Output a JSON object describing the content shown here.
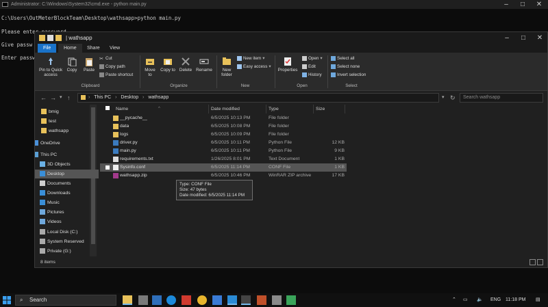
{
  "console": {
    "title": "Administrator: C:\\Windows\\System32\\cmd.exe - python main.py",
    "lines": [
      "C:\\Users\\OutMeterBlockTeam\\Desktop\\wathsapp>python main.py",
      "Please enter password",
      "Give passw",
      "Enter passw"
    ]
  },
  "explorer": {
    "title": "| wathsapp",
    "ribbon_tabs": [
      "File",
      "Home",
      "Share",
      "View"
    ],
    "ribbon": {
      "pin_quick_access": "Pin to Quick access",
      "copy": "Copy",
      "paste": "Paste",
      "cut": "Cut",
      "copy_path": "Copy path",
      "paste_shortcut": "Paste shortcut",
      "move_to": "Move to",
      "copy_to": "Copy to",
      "delete": "Delete",
      "rename": "Rename",
      "new_folder": "New folder",
      "new_item": "New item",
      "easy_access": "Easy access",
      "properties": "Properties",
      "open": "Open",
      "edit": "Edit",
      "history": "History",
      "select_all": "Select all",
      "select_none": "Select none",
      "invert_selection": "Invert selection",
      "groups": {
        "clipboard": "Clipboard",
        "organize": "Organize",
        "new": "New",
        "open": "Open",
        "select": "Select"
      }
    },
    "address": [
      "This PC",
      "Desktop",
      "wathsapp"
    ],
    "search_placeholder": "Search wathsapp",
    "nav_items": [
      {
        "label": "bmig",
        "icon": "folder-icon"
      },
      {
        "label": "test",
        "icon": "folder-icon"
      },
      {
        "label": "wathsapp",
        "icon": "folder-icon"
      },
      {
        "label": "OneDrive",
        "icon": "cloud-icon"
      },
      {
        "label": "This PC",
        "icon": "computer-icon"
      },
      {
        "label": "3D Objects",
        "icon": "cube-icon"
      },
      {
        "label": "Desktop",
        "icon": "desktop-icon"
      },
      {
        "label": "Documents",
        "icon": "documents-icon"
      },
      {
        "label": "Downloads",
        "icon": "download-icon"
      },
      {
        "label": "Music",
        "icon": "music-icon"
      },
      {
        "label": "Pictures",
        "icon": "pictures-icon"
      },
      {
        "label": "Videos",
        "icon": "videos-icon"
      },
      {
        "label": "Local Disk (C:)",
        "icon": "disk-icon"
      },
      {
        "label": "System Reserved",
        "icon": "disk-icon"
      },
      {
        "label": "Private (G:)",
        "icon": "disk-icon"
      }
    ],
    "columns": {
      "name": "Name",
      "date": "Date modified",
      "type": "Type",
      "size": "Size"
    },
    "files": [
      {
        "name": "__pycache__",
        "date": "6/5/2025 10:13 PM",
        "type": "File folder",
        "size": "",
        "icon": "folder-icon"
      },
      {
        "name": "data",
        "date": "6/5/2025 10:08 PM",
        "type": "File folder",
        "size": "",
        "icon": "folder-icon"
      },
      {
        "name": "logs",
        "date": "6/5/2025 10:09 PM",
        "type": "File folder",
        "size": "",
        "icon": "folder-icon"
      },
      {
        "name": "driver.py",
        "date": "6/5/2025 10:11 PM",
        "type": "Python File",
        "size": "12 KB",
        "icon": "python-file-icon"
      },
      {
        "name": "main.py",
        "date": "6/5/2025 10:11 PM",
        "type": "Python File",
        "size": "9 KB",
        "icon": "python-file-icon"
      },
      {
        "name": "requirements.txt",
        "date": "1/26/2025 8:01 PM",
        "type": "Text Document",
        "size": "1 KB",
        "icon": "text-file-icon"
      },
      {
        "name": "Sysinfo.conf",
        "date": "6/5/2025 11:14 PM",
        "type": "CONF File",
        "size": "1 KB",
        "icon": "file-icon"
      },
      {
        "name": "wathsapp.zip",
        "date": "6/5/2025 10:46 PM",
        "type": "WinRAR ZIP archive",
        "size": "17 KB",
        "icon": "zip-icon"
      }
    ],
    "tooltip": [
      "Type: CONF File",
      "Size: 47 bytes",
      "Date modified: 6/5/2025 11:14 PM"
    ],
    "status": "8 items"
  },
  "taskbar": {
    "search_label": "Search",
    "language": "ENG",
    "time": "11:18 PM"
  }
}
